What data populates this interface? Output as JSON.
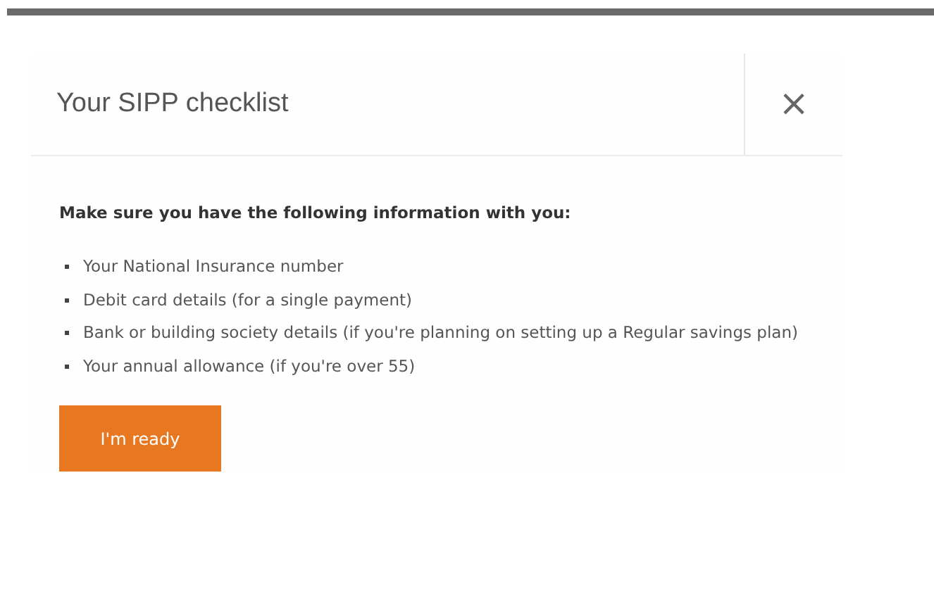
{
  "dialog": {
    "title": "Your SIPP checklist",
    "close": "×",
    "intro": "Make sure you have the following information with you:",
    "items": [
      "Your National Insurance number",
      "Debit card details (for a single payment)",
      "Bank or building society details (if you're planning on setting up a Regular savings plan)",
      "Your annual allowance (if you're over 55)"
    ],
    "button": "I'm ready"
  }
}
